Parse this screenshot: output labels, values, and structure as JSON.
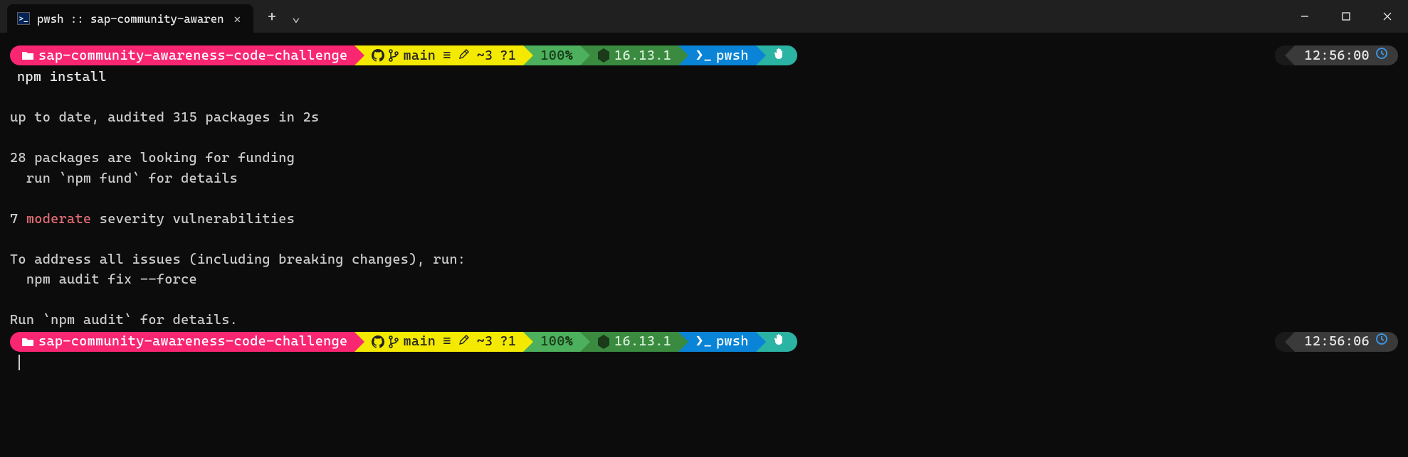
{
  "window": {
    "tab_title": "pwsh :: sap-community-awaren",
    "tab_icon": ">_"
  },
  "prompt1": {
    "path": "sap-community-awareness-code-challenge",
    "branch": "main",
    "git_status": {
      "eq": "≡",
      "pending": "~3",
      "untracked": "?1"
    },
    "battery": "100",
    "pct": "%",
    "node_ver": "16.13.1",
    "shell": "pwsh",
    "time": "12:56:00"
  },
  "command": "npm install",
  "output": {
    "l1": "up to date, audited 315 packages in 2s",
    "l2": "28 packages are looking for funding",
    "l3": "  run `npm fund` for details",
    "l4_a": "7 ",
    "l4_b": "moderate",
    "l4_c": " severity vulnerabilities",
    "l5": "To address all issues (including breaking changes), run:",
    "l6": "  npm audit fix --force",
    "l7": "Run `npm audit` for details."
  },
  "prompt2": {
    "path": "sap-community-awareness-code-challenge",
    "branch": "main",
    "git_status": {
      "eq": "≡",
      "pending": "~3",
      "untracked": "?1"
    },
    "battery": "100",
    "pct": "%",
    "node_ver": "16.13.1",
    "shell": "pwsh",
    "time": "12:56:06"
  },
  "colors": {
    "path": "#f92672",
    "git": "#f4e900",
    "battery": "#4cb05c",
    "node": "#3a8a3f",
    "shell": "#0a84d6",
    "extra": "#2bb3a3",
    "time_bg": "#3a3a3a"
  }
}
